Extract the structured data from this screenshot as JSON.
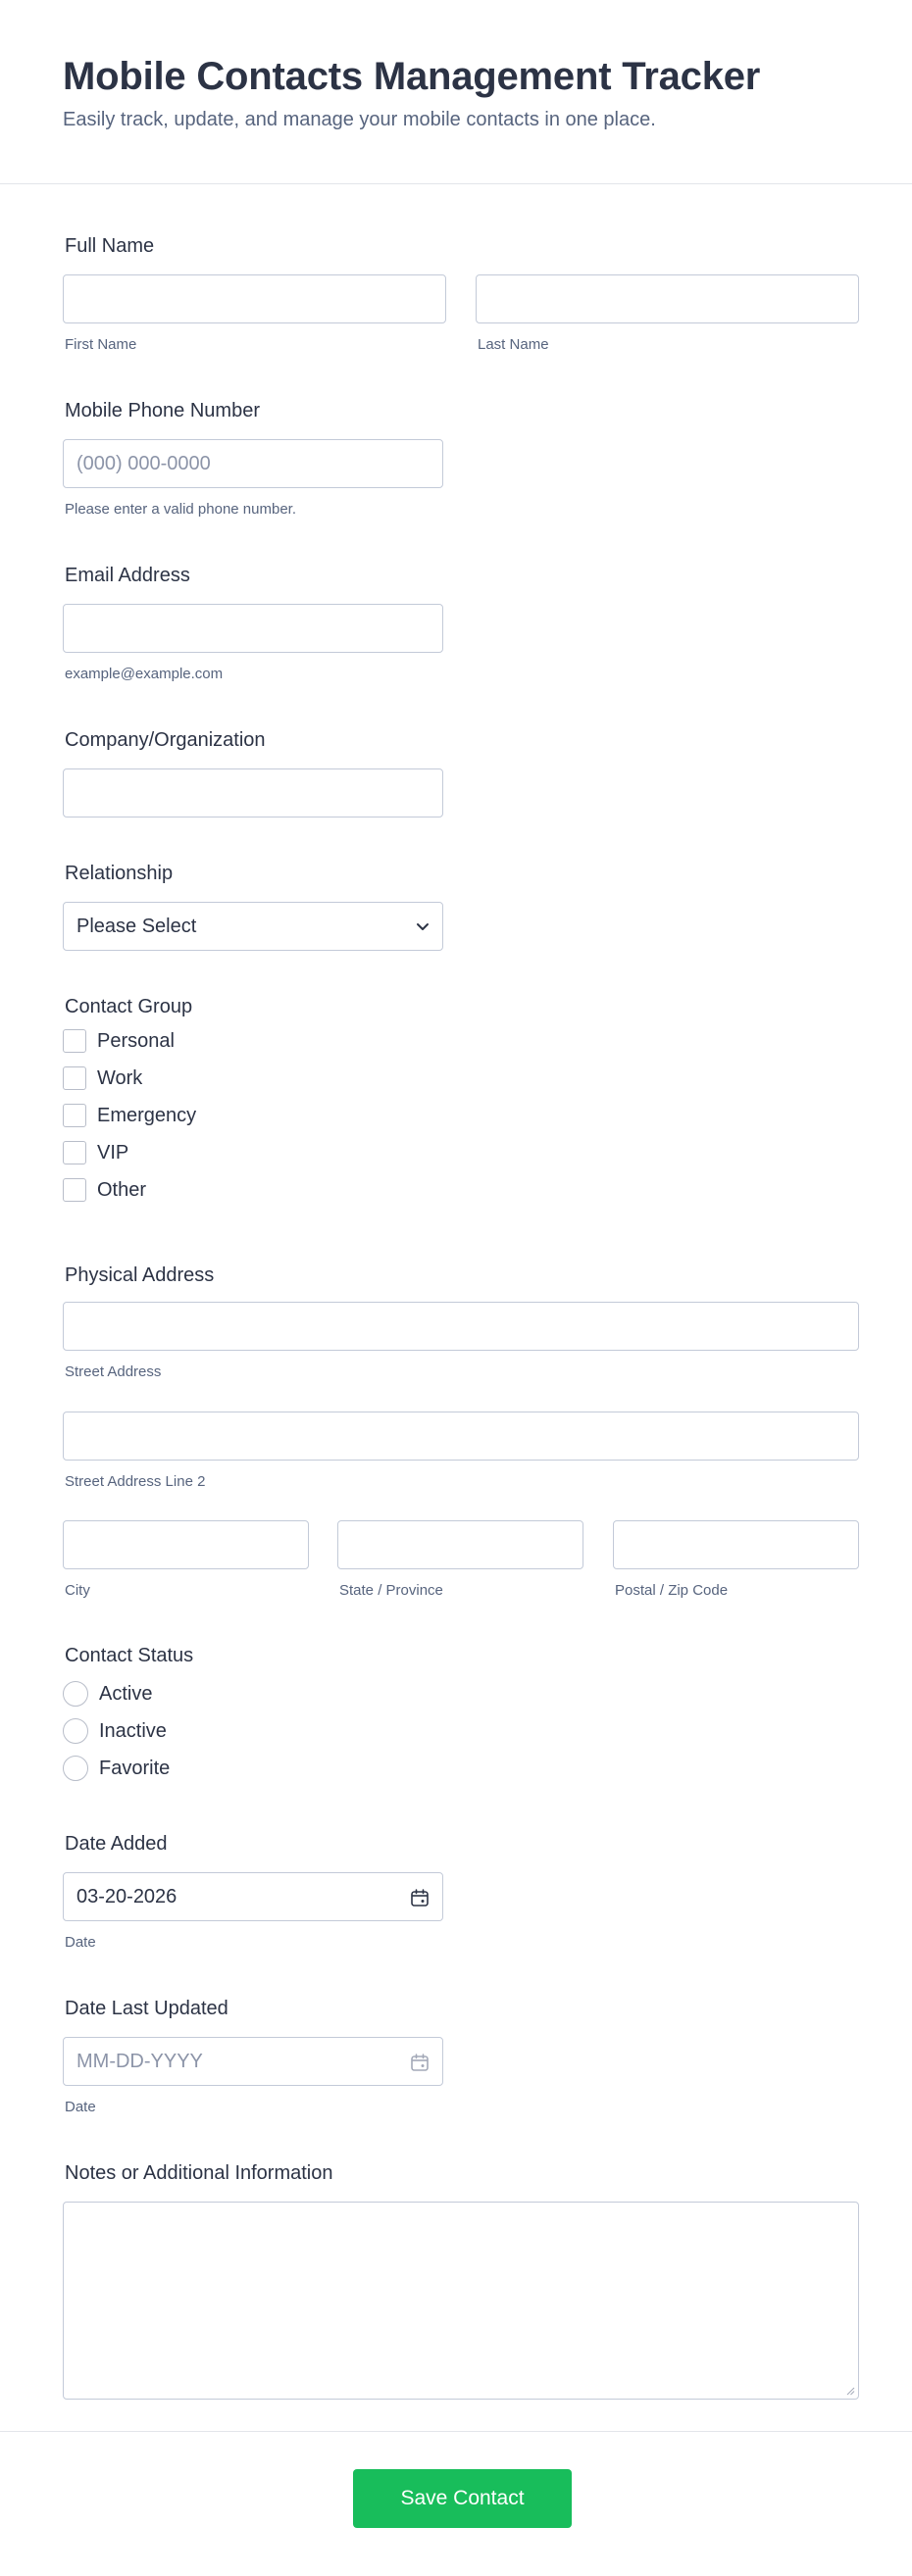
{
  "header": {
    "title": "Mobile Contacts Management Tracker",
    "subtitle": "Easily track, update, and manage your mobile contacts in one place."
  },
  "full_name": {
    "label": "Full Name",
    "first_value": "",
    "last_value": "",
    "first_sublabel": "First Name",
    "last_sublabel": "Last Name"
  },
  "phone": {
    "label": "Mobile Phone Number",
    "placeholder": "(000) 000-0000",
    "sublabel": "Please enter a valid phone number."
  },
  "email": {
    "label": "Email Address",
    "value": "",
    "sublabel": "example@example.com"
  },
  "company": {
    "label": "Company/Organization",
    "value": ""
  },
  "relationship": {
    "label": "Relationship",
    "selected": "Please Select"
  },
  "contact_group": {
    "label": "Contact Group",
    "options": [
      "Personal",
      "Work",
      "Emergency",
      "VIP",
      "Other"
    ]
  },
  "address": {
    "label": "Physical Address",
    "street_sublabel": "Street Address",
    "street2_sublabel": "Street Address Line 2",
    "city_sublabel": "City",
    "state_sublabel": "State / Province",
    "zip_sublabel": "Postal / Zip Code"
  },
  "contact_status": {
    "label": "Contact Status",
    "options": [
      "Active",
      "Inactive",
      "Favorite"
    ]
  },
  "date_added": {
    "label": "Date Added",
    "value": "03-20-2026",
    "sublabel": "Date",
    "icon": "calendar-icon"
  },
  "date_updated": {
    "label": "Date Last Updated",
    "placeholder": "MM-DD-YYYY",
    "sublabel": "Date",
    "icon": "calendar-icon"
  },
  "notes": {
    "label": "Notes or Additional Information",
    "value": ""
  },
  "footer": {
    "submit_label": "Save Contact"
  },
  "colors": {
    "primary_text": "#2c3345",
    "secondary_text": "#57647e",
    "border": "#c3cad8",
    "submit_bg": "#18bd5b"
  }
}
